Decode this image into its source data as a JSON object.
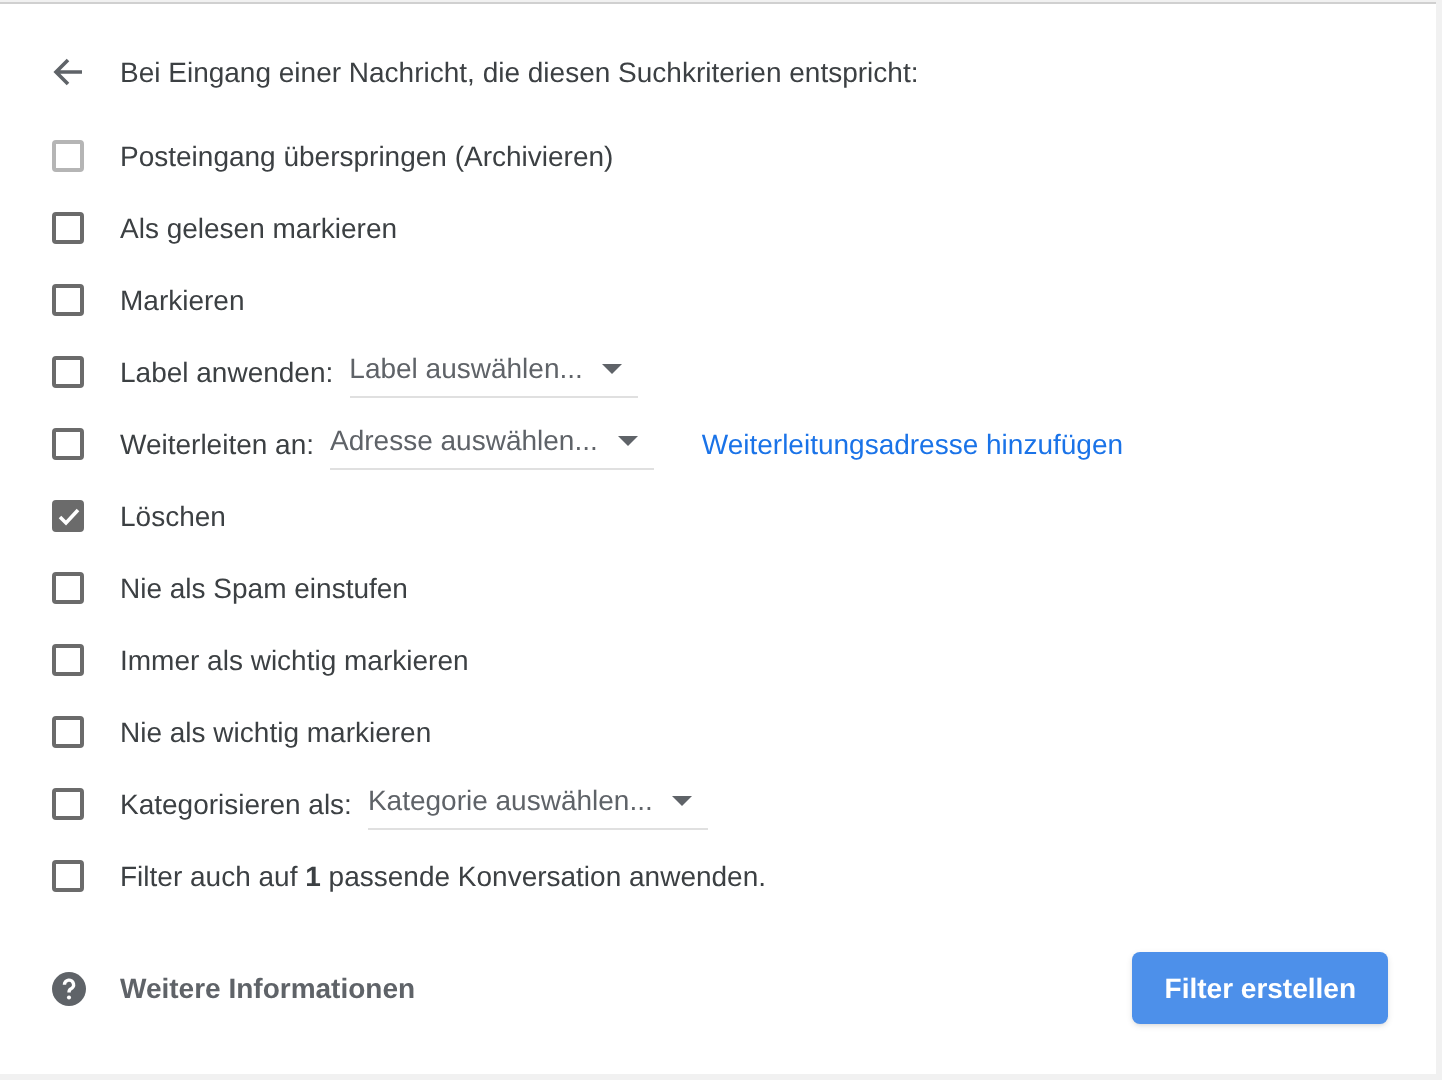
{
  "header": {
    "title": "Bei Eingang einer Nachricht, die diesen Suchkriterien entspricht:"
  },
  "options": [
    {
      "kind": "plain",
      "label": "Posteingang überspringen (Archivieren)",
      "checked": false,
      "disabled": true
    },
    {
      "kind": "plain",
      "label": "Als gelesen markieren",
      "checked": false,
      "disabled": false
    },
    {
      "kind": "plain",
      "label": "Markieren",
      "checked": false,
      "disabled": false
    },
    {
      "kind": "select",
      "label": "Label anwenden:",
      "select": "Label auswählen...",
      "checked": false,
      "disabled": false
    },
    {
      "kind": "select",
      "label": "Weiterleiten an:",
      "select": "Adresse auswählen...",
      "link": "Weiterleitungsadresse hinzufügen",
      "checked": false,
      "disabled": false
    },
    {
      "kind": "plain",
      "label": "Löschen",
      "checked": true,
      "disabled": false
    },
    {
      "kind": "plain",
      "label": "Nie als Spam einstufen",
      "checked": false,
      "disabled": false
    },
    {
      "kind": "plain",
      "label": "Immer als wichtig markieren",
      "checked": false,
      "disabled": false
    },
    {
      "kind": "plain",
      "label": "Nie als wichtig markieren",
      "checked": false,
      "disabled": false
    },
    {
      "kind": "select",
      "label": "Kategorisieren als:",
      "select": "Kategorie auswählen...",
      "checked": false,
      "disabled": false
    },
    {
      "kind": "rich",
      "label": "Filter auch auf **1** passende Konversation anwenden.",
      "checked": false,
      "disabled": false
    }
  ],
  "footer": {
    "help": "Weitere Informationen",
    "button": "Filter erstellen"
  }
}
